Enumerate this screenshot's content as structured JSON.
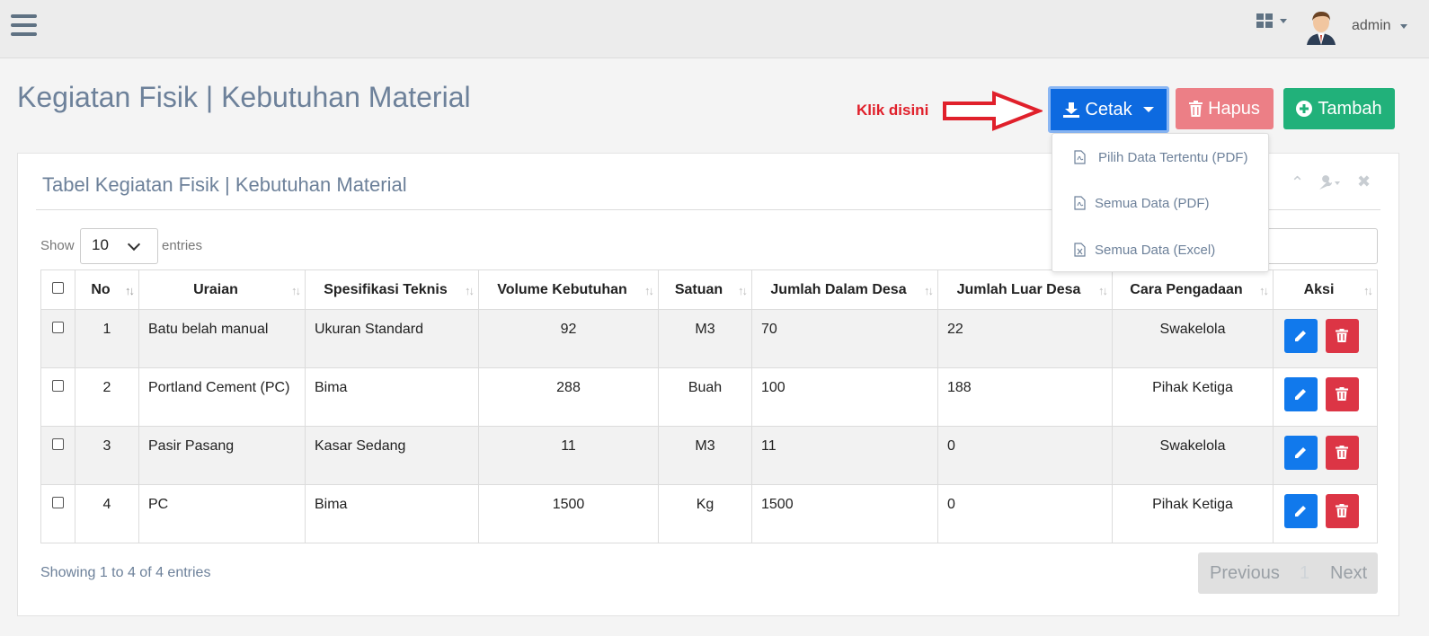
{
  "header": {
    "user_name": "admin",
    "menu_icon": "hamburger-icon",
    "apps_icon": "grid-icon"
  },
  "page": {
    "title": "Kegiatan Fisik | Kebutuhan Material",
    "hint": "Klik disini"
  },
  "toolbar": {
    "print_label": "Cetak",
    "delete_label": "Hapus",
    "add_label": "Tambah",
    "colors": {
      "print": "#0d6ae0",
      "delete": "#ec7f86",
      "add": "#21b17a"
    }
  },
  "print_menu": {
    "items": [
      {
        "label": "Pilih Data Tertentu (PDF)",
        "icon": "pdf-file-icon"
      },
      {
        "label": "Semua Data (PDF)",
        "icon": "pdf-file-icon"
      },
      {
        "label": "Semua Data (Excel)",
        "icon": "excel-file-icon"
      }
    ]
  },
  "card": {
    "title": "Tabel Kegiatan Fisik | Kebutuhan Material"
  },
  "table_controls": {
    "show_label": "Show",
    "page_length": "10",
    "entries_label": "entries"
  },
  "table": {
    "columns": [
      "No",
      "Uraian",
      "Spesifikasi Teknis",
      "Volume Kebutuhan",
      "Satuan",
      "Jumlah Dalam Desa",
      "Jumlah Luar Desa",
      "Cara Pengadaan",
      "Aksi"
    ],
    "rows": [
      {
        "no": "1",
        "uraian": "Batu belah manual",
        "spesifikasi": "Ukuran Standard",
        "volume": "92",
        "satuan": "M3",
        "dalam_desa": "70",
        "luar_desa": "22",
        "cara": "Swakelola"
      },
      {
        "no": "2",
        "uraian": "Portland Cement (PC)",
        "spesifikasi": "Bima",
        "volume": "288",
        "satuan": "Buah",
        "dalam_desa": "100",
        "luar_desa": "188",
        "cara": "Pihak Ketiga"
      },
      {
        "no": "3",
        "uraian": "Pasir Pasang",
        "spesifikasi": "Kasar Sedang",
        "volume": "11",
        "satuan": "M3",
        "dalam_desa": "11",
        "luar_desa": "0",
        "cara": "Swakelola"
      },
      {
        "no": "4",
        "uraian": "PC",
        "spesifikasi": "Bima",
        "volume": "1500",
        "satuan": "Kg",
        "dalam_desa": "1500",
        "luar_desa": "0",
        "cara": "Pihak Ketiga"
      }
    ]
  },
  "footer": {
    "info": "Showing 1 to 4 of 4 entries",
    "previous": "Previous",
    "page": "1",
    "next": "Next"
  }
}
